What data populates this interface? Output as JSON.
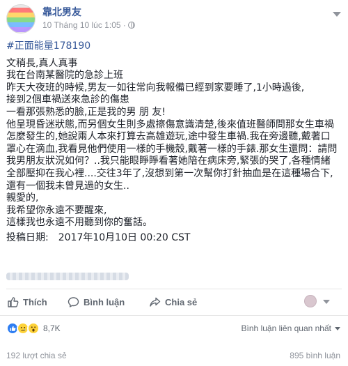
{
  "colors": {
    "link": "#365899",
    "meta": "#90949c",
    "text": "#1d2129",
    "like_blue": "#2e7ef2"
  },
  "post": {
    "page_name": "靠北男友",
    "timestamp": "10 Tháng 10 lúc 1:05 ·",
    "privacy_icon": "globe-icon",
    "hashtag": "#正面能量178190",
    "lines": [
      "文稍長,真人真事",
      "我在台南某醫院的急診上班",
      "昨天大夜班的時候,男友一如往常向我報備已經到家要睡了,1小時過後,",
      "接到2個車禍送來急診的傷患",
      "一看那張熟悉的臉,正是我的男 朋 友!",
      "他呈現昏迷狀態,而另個女生則多處擦傷意識清楚,後來值班醫師問那女生車禍",
      "怎麼發生的,她說兩人本來打算去高雄遊玩,途中發生車禍.我在旁邊聽,戴著口",
      "罩心在滴血,我看見他們使用一樣的手機殼,戴著一樣的手錶.那女生還問：請問",
      "我男朋友狀況如何？..我只能眼睜睜看著她陪在病床旁,緊張的哭了,各種情緒",
      "全部壓抑在我心裡....交往3年了,沒想到第一次幫你打針抽血是在這種場合下,",
      "還有一個我未曾見過的女生..",
      "親愛的,",
      "我希望你永遠不要醒來,",
      "這樣我也永遠不用聽到你的奮話。",
      "投稿日期:　2017年10月10日 00:20 CST"
    ]
  },
  "actions": {
    "like_label": "Thích",
    "comment_label": "Bình luận",
    "share_label": "Chia sẻ"
  },
  "reactions": {
    "count": "8,7K",
    "sort_label": "Bình luận liên quan nhất"
  },
  "stats": {
    "shares": "192 lượt chia sẻ",
    "comments": "895 bình luận"
  }
}
